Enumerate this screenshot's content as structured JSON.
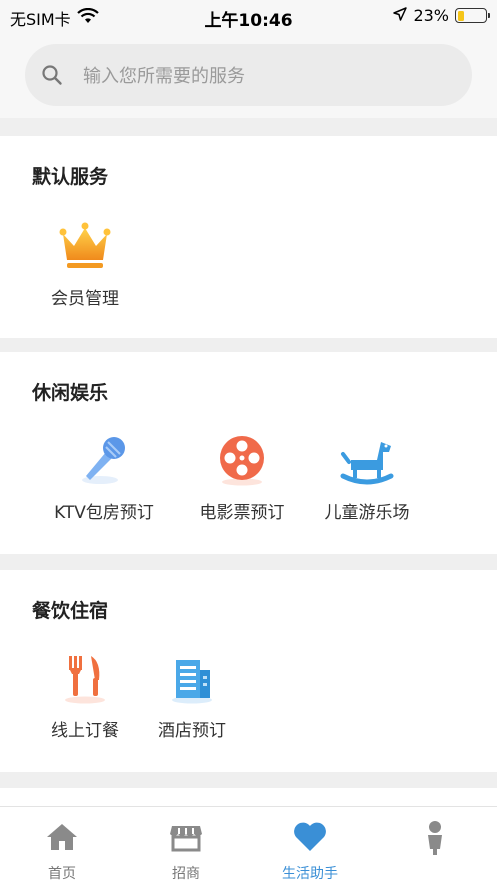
{
  "status_bar": {
    "carrier": "无SIM卡",
    "time": "上午10:46",
    "battery_percent": "23%",
    "battery_level": 0.23,
    "icons": [
      "wifi-icon",
      "location-arrow-icon",
      "battery-icon"
    ]
  },
  "search": {
    "placeholder": "输入您所需要的服务"
  },
  "sections": [
    {
      "title": "默认服务",
      "items": [
        {
          "label": "会员管理",
          "icon": "crown-icon"
        }
      ]
    },
    {
      "title": "休闲娱乐",
      "items": [
        {
          "label": "KTV包房预订",
          "icon": "microphone-icon"
        },
        {
          "label": "电影票预订",
          "icon": "film-reel-icon"
        },
        {
          "label": "儿童游乐场",
          "icon": "rocking-horse-icon"
        }
      ]
    },
    {
      "title": "餐饮住宿",
      "items": [
        {
          "label": "线上订餐",
          "icon": "fork-knife-icon"
        },
        {
          "label": "酒店预订",
          "icon": "hotel-building-icon"
        }
      ]
    }
  ],
  "tabbar": {
    "tabs": [
      {
        "label": "首页",
        "icon": "home-icon",
        "active": false
      },
      {
        "label": "招商",
        "icon": "storefront-icon",
        "active": false
      },
      {
        "label": "生活助手",
        "icon": "heart-icon",
        "active": true
      },
      {
        "label": "",
        "icon": "person-icon",
        "active": false
      }
    ]
  },
  "colors": {
    "accent": "#3a8fd6",
    "crown": "#f5a623",
    "film": "#f06a4a",
    "fork": "#f0703f",
    "hotel": "#4aa8e8",
    "horse": "#3b9be0",
    "mic": "#6aa6f0"
  }
}
